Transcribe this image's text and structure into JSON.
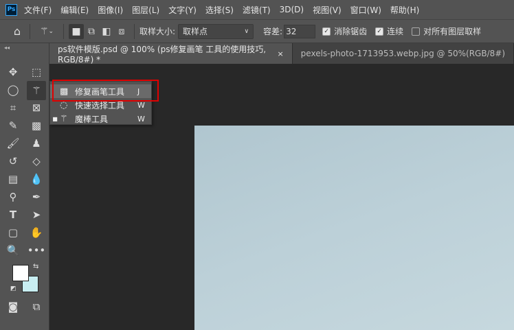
{
  "app": {
    "logo": "Ps"
  },
  "menu": [
    "文件(F)",
    "编辑(E)",
    "图像(I)",
    "图层(L)",
    "文字(Y)",
    "选择(S)",
    "滤镜(T)",
    "3D(D)",
    "视图(V)",
    "窗口(W)",
    "帮助(H)"
  ],
  "options": {
    "sample_size_label": "取样大小:",
    "sample_size_value": "取样点",
    "tolerance_label": "容差:",
    "tolerance_value": "32",
    "antialias_label": "消除锯齿",
    "antialias_checked": true,
    "contiguous_label": "连续",
    "contiguous_checked": true,
    "all_layers_label": "对所有图层取样",
    "all_layers_checked": false
  },
  "tabs": [
    {
      "label": "ps软件模版.psd @ 100% (ps修复画笔 工具的使用技巧, RGB/8#) *",
      "close": "×"
    },
    {
      "label": "pexels-photo-1713953.webp.jpg @ 50%(RGB/8#)"
    }
  ],
  "flyout": [
    {
      "label": "修复画笔工具",
      "key": "J",
      "mark": ""
    },
    {
      "label": "快速选择工具",
      "key": "W",
      "mark": ""
    },
    {
      "label": "魔棒工具",
      "key": "W",
      "mark": "■"
    }
  ],
  "colors": {
    "foreground": "#ffffff",
    "background": "#c8eef2",
    "highlight": "#e00000"
  }
}
